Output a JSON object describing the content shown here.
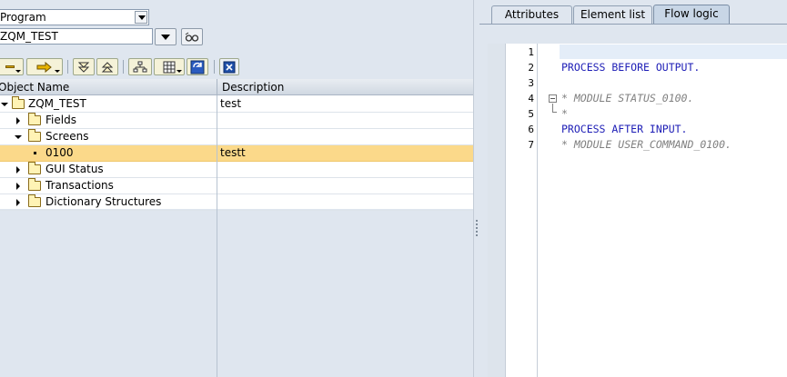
{
  "object_selector": {
    "type_value": "Program",
    "name_value": "ZQM_TEST"
  },
  "toolbar": {
    "icons": [
      "collapse-icon",
      "forward-arrow-icon",
      "expand-all-icon",
      "collapse-all-icon",
      "hierarchy-icon",
      "grid-icon",
      "refresh-icon",
      "close-x-icon"
    ]
  },
  "tree": {
    "headers": {
      "object_name": "Object Name",
      "description": "Description"
    },
    "rows": [
      {
        "name": "ZQM_TEST",
        "description": "test"
      },
      {
        "name": "Fields",
        "description": ""
      },
      {
        "name": "Screens",
        "description": ""
      },
      {
        "name": "0100",
        "description": "testt"
      },
      {
        "name": "GUI Status",
        "description": ""
      },
      {
        "name": "Transactions",
        "description": ""
      },
      {
        "name": "Dictionary Structures",
        "description": ""
      }
    ]
  },
  "tabs": [
    {
      "label": "Attributes"
    },
    {
      "label": "Element list"
    },
    {
      "label": "Flow logic"
    }
  ],
  "active_tab": "Flow logic",
  "editor": {
    "lines": [
      {
        "num": "1",
        "text": ""
      },
      {
        "num": "2",
        "text": "PROCESS BEFORE OUTPUT."
      },
      {
        "num": "3",
        "text": ""
      },
      {
        "num": "4",
        "text": "* MODULE STATUS_0100."
      },
      {
        "num": "5",
        "text": "*"
      },
      {
        "num": "6",
        "text": "PROCESS AFTER INPUT."
      },
      {
        "num": "7",
        "text": "* MODULE USER_COMMAND_0100."
      }
    ]
  },
  "colors": {
    "keyword": "#1d1db6",
    "comment": "#808080",
    "selected_row": "#fbd98a"
  }
}
